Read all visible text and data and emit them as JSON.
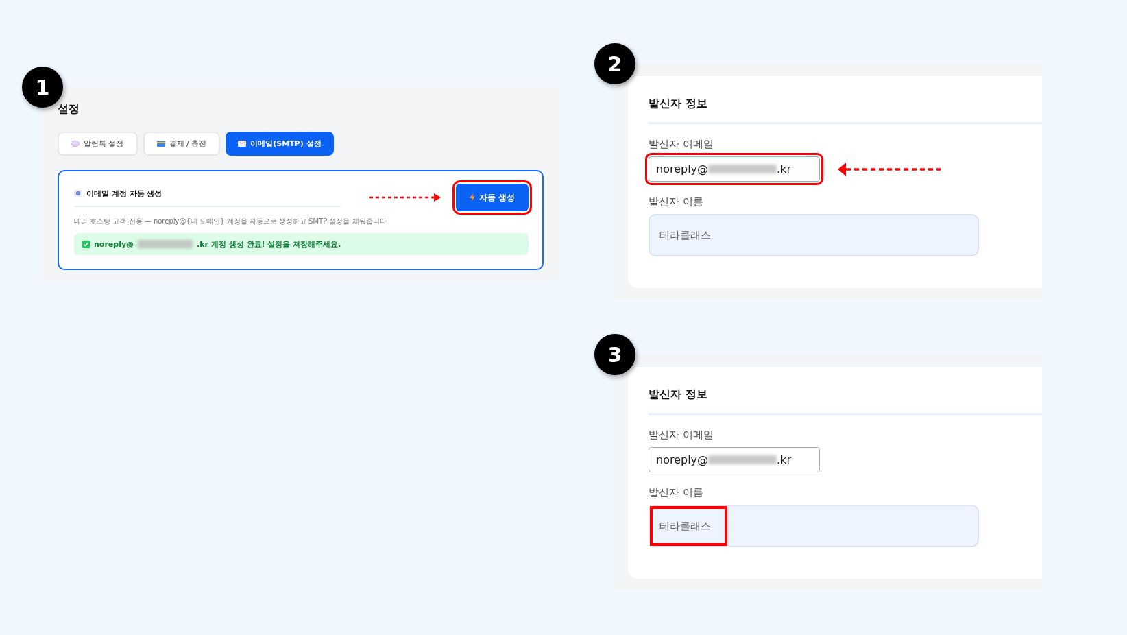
{
  "panels": [
    {
      "kind": "settings",
      "step": "1",
      "title": "설정",
      "tabs": [
        {
          "label": "알림톡 설정",
          "selected": false
        },
        {
          "label": "결제 / 충전",
          "selected": false
        },
        {
          "label": "이메일(SMTP) 설정",
          "selected": true
        }
      ],
      "card": {
        "title": "이메일 계정 자동 생성",
        "description": "테라 호스팅 고객 전용 — noreply@{내 도메인} 계정을 자동으로 생성하고 SMTP 설정을 채워줍니다",
        "button": "자동 생성",
        "button_highlighted": true,
        "success_start": "noreply@",
        "success_end": ".kr 계정 생성 완료! 설정을 저장해주세요."
      }
    },
    {
      "kind": "sender",
      "step": "2",
      "title": "발신자 정보",
      "fields": [
        {
          "kind": "email",
          "label": "발신자 이메일",
          "value_start": "noreply@",
          "value_end": ".kr",
          "highlighted": true
        },
        {
          "kind": "name",
          "label": "발신자 이름",
          "value": "테라클래스",
          "highlighted": false
        }
      ]
    },
    {
      "kind": "sender",
      "step": "3",
      "title": "발신자 정보",
      "fields": [
        {
          "kind": "email",
          "label": "발신자 이메일",
          "value_start": "noreply@",
          "value_end": ".kr",
          "highlighted": false
        },
        {
          "kind": "name",
          "label": "발신자 이름",
          "value": "테라클래스",
          "highlighted": true
        }
      ]
    }
  ]
}
